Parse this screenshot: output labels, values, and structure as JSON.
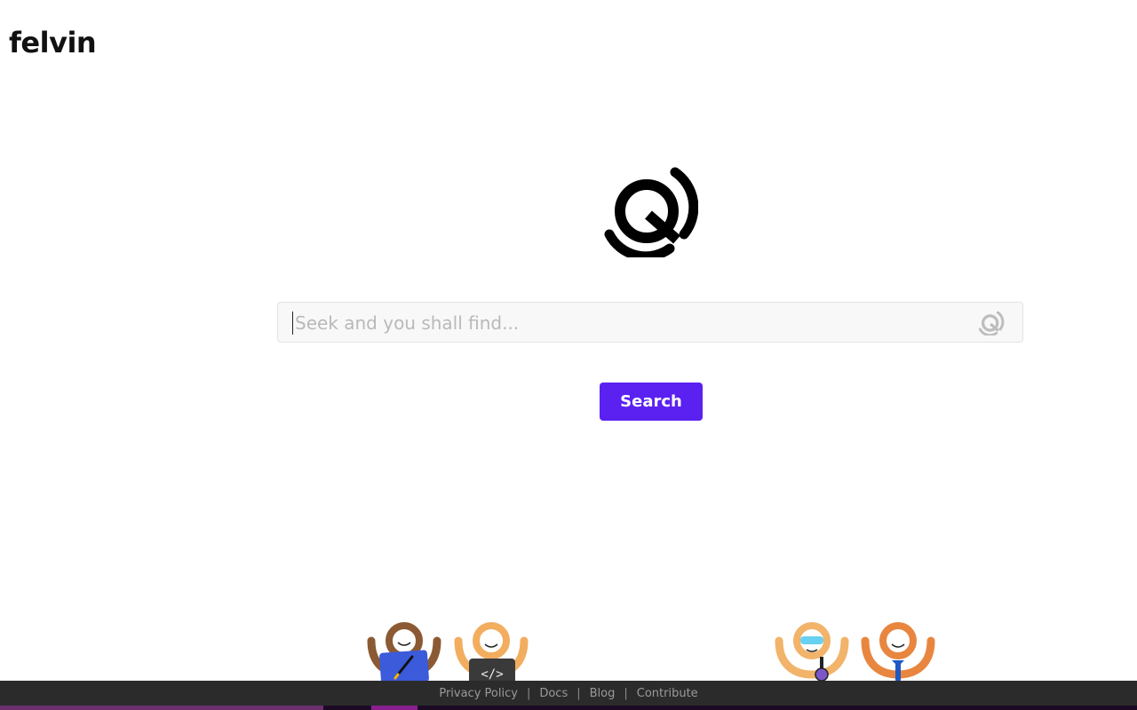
{
  "brand": {
    "name": "felvin"
  },
  "search": {
    "placeholder": "Seek and you shall find...",
    "value": ""
  },
  "search_button": {
    "label": "Search"
  },
  "footer": {
    "links": [
      "Privacy Policy",
      "Docs",
      "Blog",
      "Contribute"
    ],
    "separator": "|"
  },
  "colors": {
    "accent": "#5b21f0",
    "footer_bg": "#2b2b2b",
    "footer_text": "#9a9a9a"
  },
  "icons": {
    "hero": "felvin-q-logo-icon",
    "search_field": "felvin-q-logo-icon",
    "mascots": [
      "designer-mascot-icon",
      "developer-mascot-icon",
      "scientist-mascot-icon",
      "business-mascot-icon"
    ]
  }
}
